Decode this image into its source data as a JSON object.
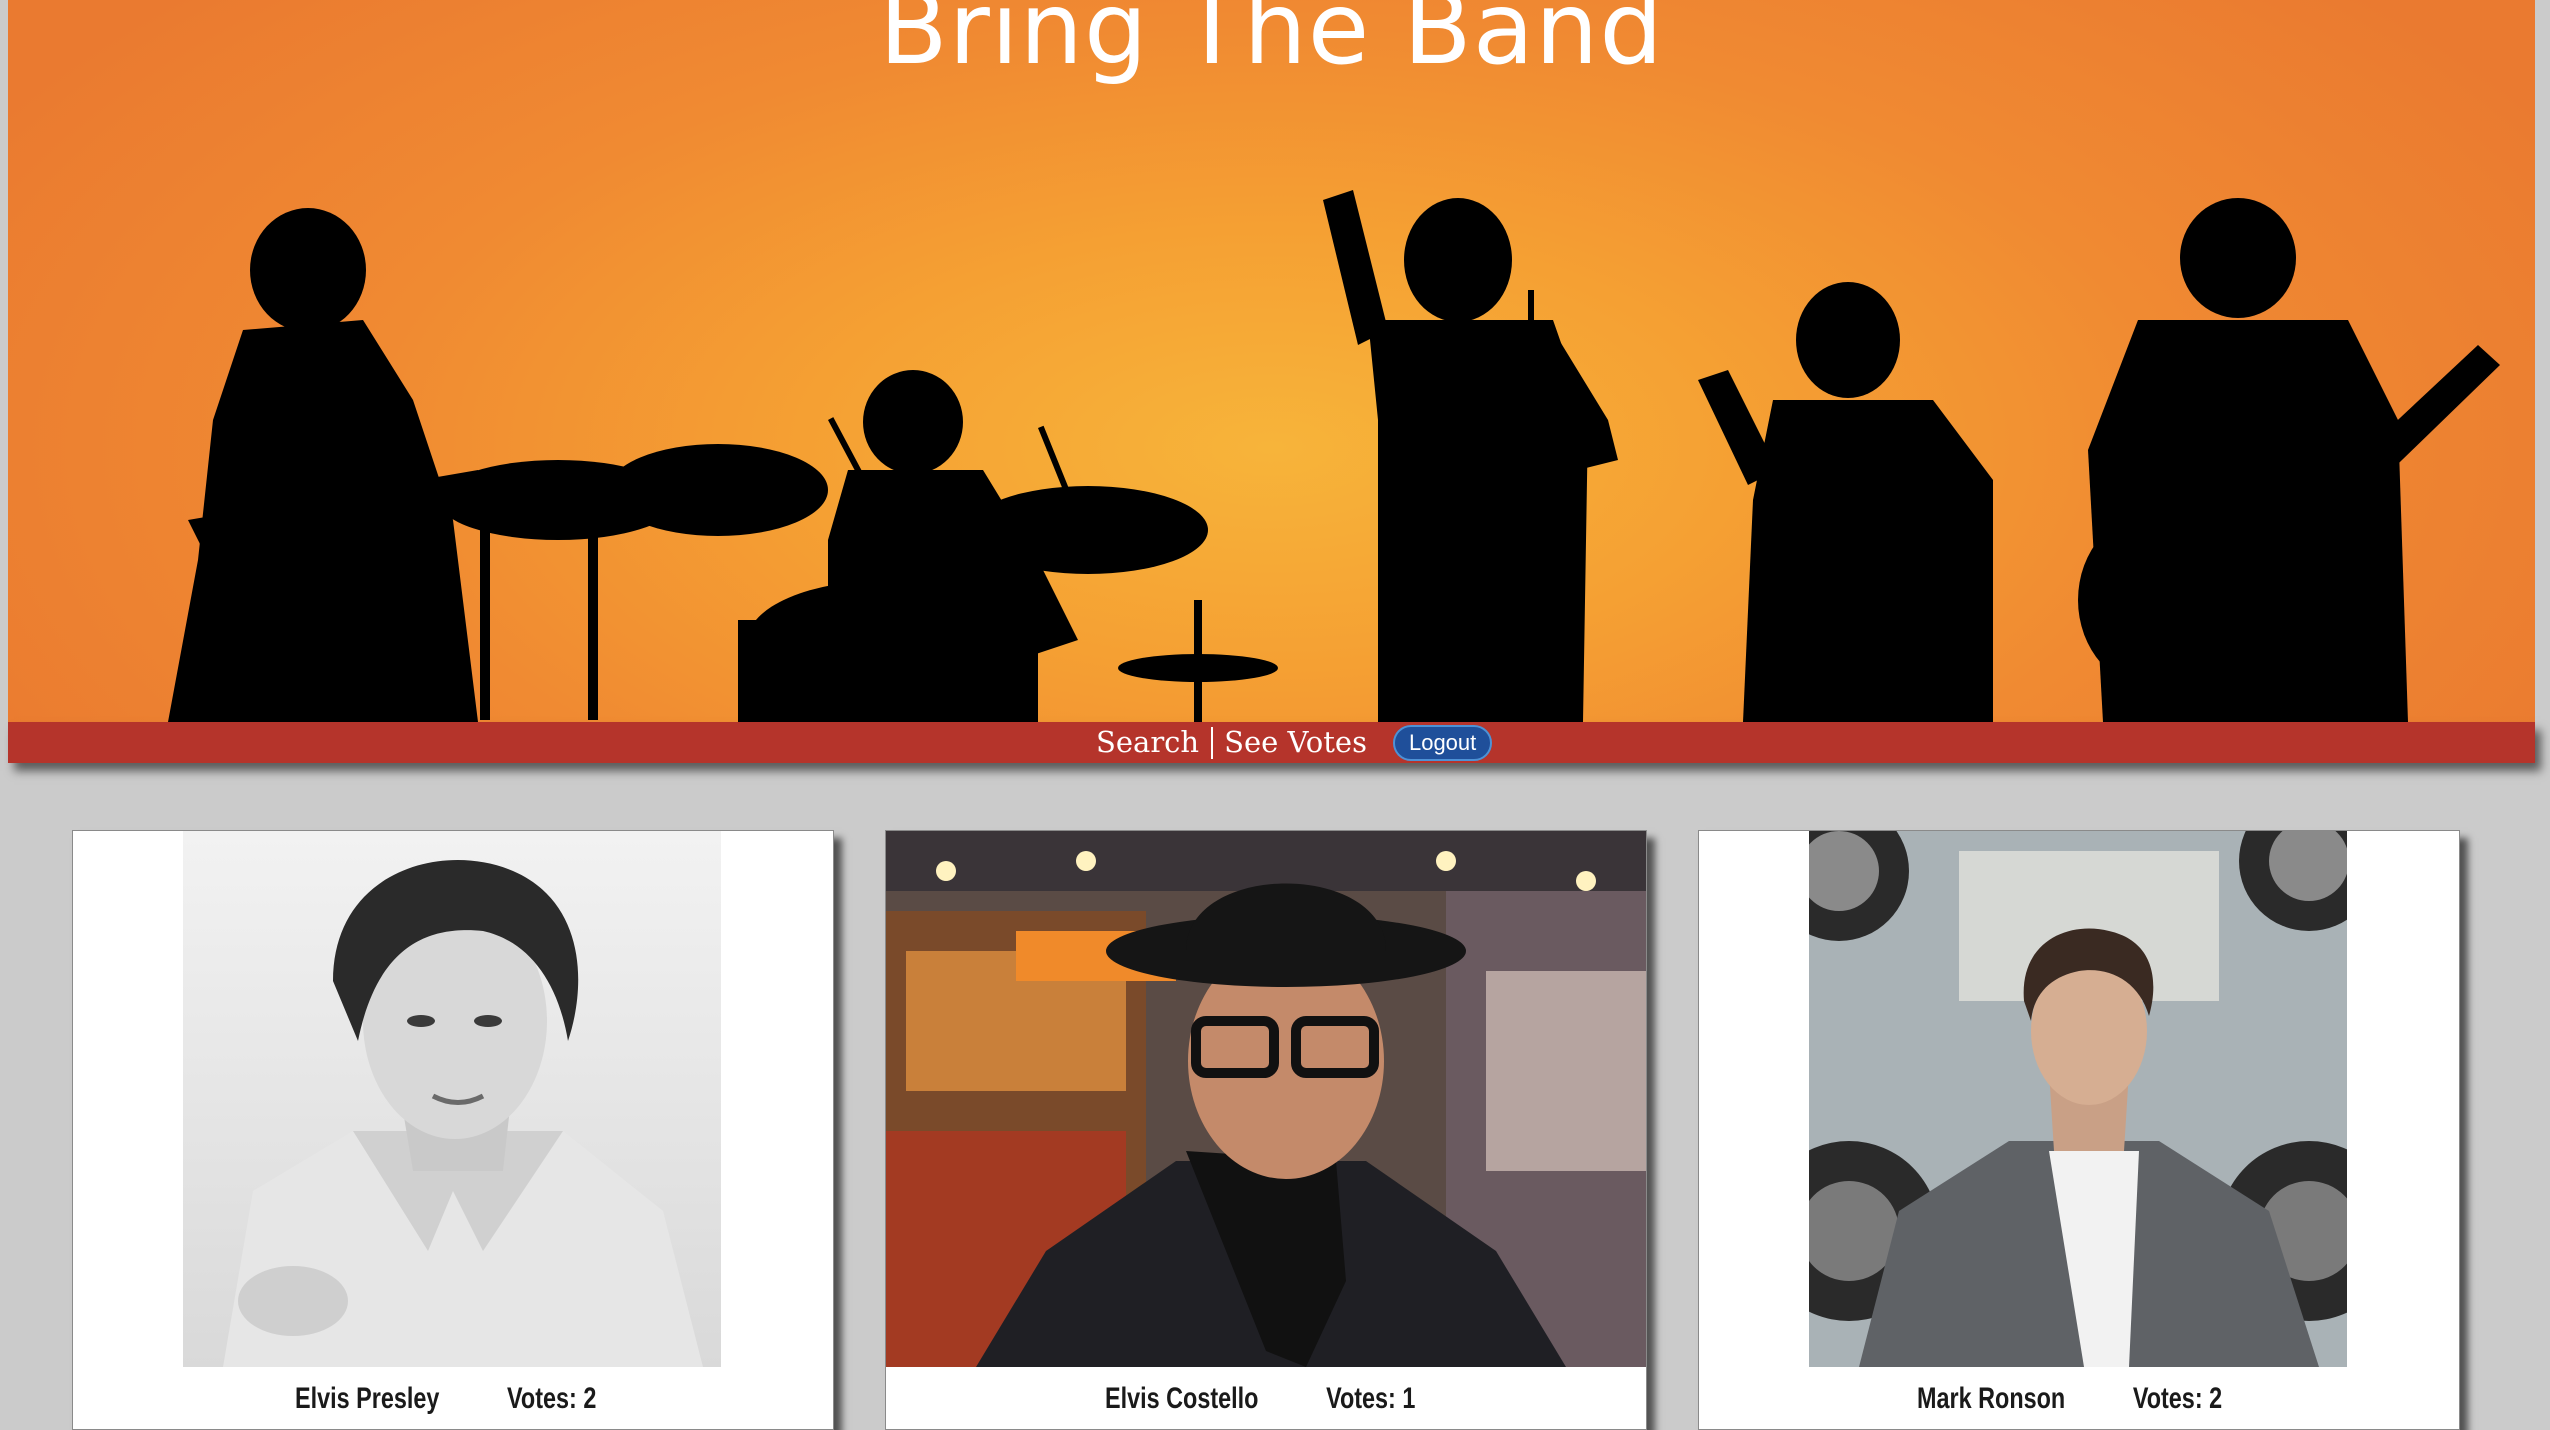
{
  "hero": {
    "title": "Bring The Band"
  },
  "nav": {
    "search_label": "Search",
    "votes_label": "See Votes",
    "logout_label": "Logout"
  },
  "cards": [
    {
      "name": "Elvis Presley",
      "votes_label": "Votes: 2"
    },
    {
      "name": "Elvis Costello",
      "votes_label": "Votes: 1"
    },
    {
      "name": "Mark Ronson",
      "votes_label": "Votes: 2"
    }
  ]
}
